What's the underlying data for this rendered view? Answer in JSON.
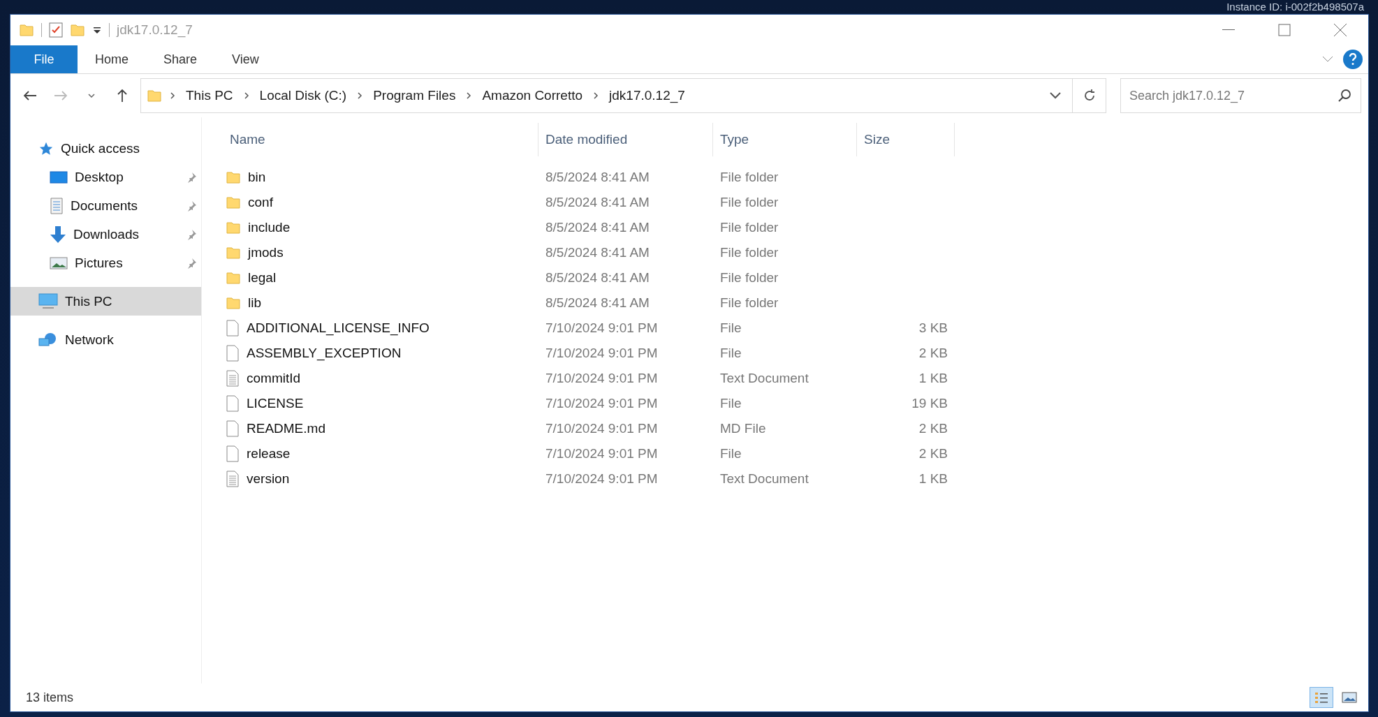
{
  "desktop_text": "Instance ID: i-002f2b498507a",
  "window": {
    "title": "jdk17.0.12_7"
  },
  "ribbon_tabs": [
    {
      "label": "File",
      "selected": true
    },
    {
      "label": "Home",
      "selected": false
    },
    {
      "label": "Share",
      "selected": false
    },
    {
      "label": "View",
      "selected": false
    }
  ],
  "breadcrumb": [
    "This PC",
    "Local Disk (C:)",
    "Program Files",
    "Amazon Corretto",
    "jdk17.0.12_7"
  ],
  "search": {
    "placeholder": "Search jdk17.0.12_7"
  },
  "sidebar": {
    "items": [
      {
        "label": "Quick access",
        "kind": "quick",
        "pinned": false,
        "selected": false,
        "children": [
          {
            "label": "Desktop",
            "kind": "desktop",
            "pinned": true,
            "selected": false
          },
          {
            "label": "Documents",
            "kind": "documents",
            "pinned": true,
            "selected": false
          },
          {
            "label": "Downloads",
            "kind": "downloads",
            "pinned": true,
            "selected": false
          },
          {
            "label": "Pictures",
            "kind": "pictures",
            "pinned": true,
            "selected": false
          }
        ]
      },
      {
        "label": "This PC",
        "kind": "pc",
        "pinned": false,
        "selected": true
      },
      {
        "label": "Network",
        "kind": "network",
        "pinned": false,
        "selected": false
      }
    ]
  },
  "table": {
    "columns": [
      "Name",
      "Date modified",
      "Type",
      "Size"
    ],
    "rows": [
      {
        "kind": "folder",
        "name": "bin",
        "date": "8/5/2024 8:41 AM",
        "type": "File folder"
      },
      {
        "kind": "folder",
        "name": "conf",
        "date": "8/5/2024 8:41 AM",
        "type": "File folder"
      },
      {
        "kind": "folder",
        "name": "include",
        "date": "8/5/2024 8:41 AM",
        "type": "File folder"
      },
      {
        "kind": "folder",
        "name": "jmods",
        "date": "8/5/2024 8:41 AM",
        "type": "File folder"
      },
      {
        "kind": "folder",
        "name": "legal",
        "date": "8/5/2024 8:41 AM",
        "type": "File folder"
      },
      {
        "kind": "folder",
        "name": "lib",
        "date": "8/5/2024 8:41 AM",
        "type": "File folder"
      },
      {
        "kind": "file",
        "name": "ADDITIONAL_LICENSE_INFO",
        "date": "7/10/2024 9:01 PM",
        "type": "File",
        "size": "3 KB"
      },
      {
        "kind": "file",
        "name": "ASSEMBLY_EXCEPTION",
        "date": "7/10/2024 9:01 PM",
        "type": "File",
        "size": "2 KB"
      },
      {
        "kind": "text",
        "name": "commitId",
        "date": "7/10/2024 9:01 PM",
        "type": "Text Document",
        "size": "1 KB"
      },
      {
        "kind": "file",
        "name": "LICENSE",
        "date": "7/10/2024 9:01 PM",
        "type": "File",
        "size": "19 KB"
      },
      {
        "kind": "file",
        "name": "README.md",
        "date": "7/10/2024 9:01 PM",
        "type": "MD File",
        "size": "2 KB"
      },
      {
        "kind": "file",
        "name": "release",
        "date": "7/10/2024 9:01 PM",
        "type": "File",
        "size": "2 KB"
      },
      {
        "kind": "text",
        "name": "version",
        "date": "7/10/2024 9:01 PM",
        "type": "Text Document",
        "size": "1 KB"
      }
    ]
  },
  "status_bar": {
    "count": "13 items"
  }
}
